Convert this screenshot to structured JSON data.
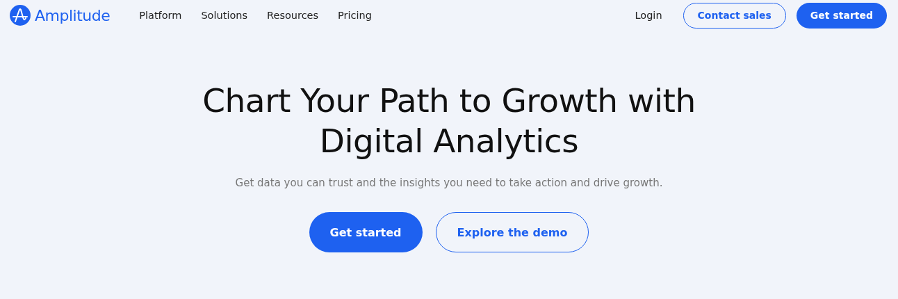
{
  "header": {
    "logo": "Amplitude",
    "nav": [
      "Platform",
      "Solutions",
      "Resources",
      "Pricing"
    ],
    "actions": [
      {
        "label": "Login",
        "kind": "link"
      },
      {
        "label": "Contact sales",
        "kind": "outline"
      },
      {
        "label": "Get started",
        "kind": "primary"
      }
    ]
  },
  "hero": {
    "title_lines": [
      "Chart Your Path to Growth with",
      "Digital Analytics"
    ],
    "subtitle": "Get data you can trust and the insights you need to take action and drive growth.",
    "buttons": [
      {
        "label": "Get started",
        "kind": "primary"
      },
      {
        "label": "Explore the demo",
        "kind": "outline"
      }
    ]
  }
}
